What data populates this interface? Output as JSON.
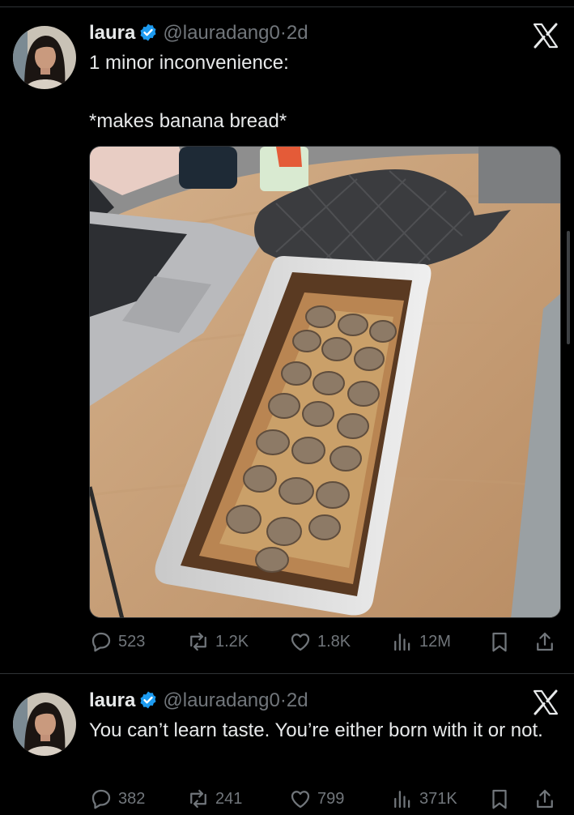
{
  "tweets": [
    {
      "name": "laura",
      "handle": "@lauradang0",
      "separator": "·",
      "time": "2d",
      "text": "1 minor inconvenience:\n\n*makes banana bread*",
      "metrics": {
        "replies": "523",
        "reposts": "1.2K",
        "likes": "1.8K",
        "views": "12M"
      }
    },
    {
      "name": "laura",
      "handle": "@lauradang0",
      "separator": "·",
      "time": "2d",
      "text": "You can’t learn taste. You’re either born with it or not.",
      "metrics": {
        "replies": "382",
        "reposts": "241",
        "likes": "799",
        "views": "371K"
      }
    }
  ],
  "icons": {
    "verified": "verified-badge-icon",
    "platform": "x-logo-icon",
    "reply": "reply-icon",
    "repost": "repost-icon",
    "like": "like-icon",
    "views": "views-icon",
    "bookmark": "bookmark-icon",
    "share": "share-icon"
  },
  "colors": {
    "background": "#000000",
    "text": "#e7e9ea",
    "muted": "#71767b",
    "verified": "#1d9bf0",
    "divider": "#2f3336"
  }
}
